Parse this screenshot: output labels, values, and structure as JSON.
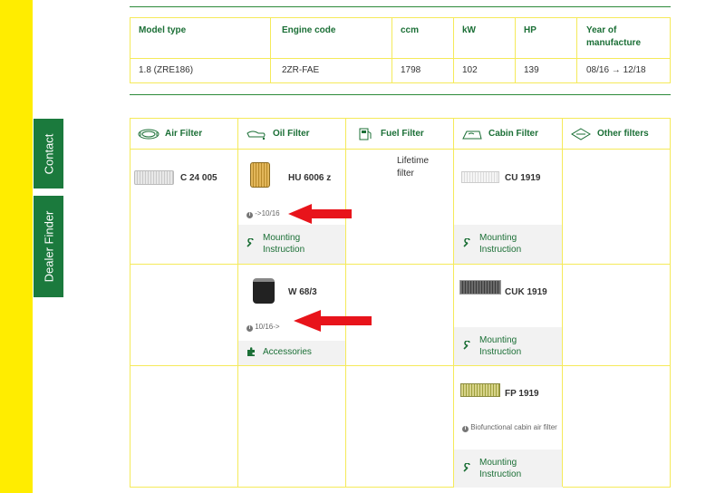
{
  "vehicle_table": {
    "headers": [
      "Model type",
      "Engine code",
      "ccm",
      "kW",
      "HP",
      "Year of\nmanufacture"
    ],
    "row": [
      "1.8 (ZRE186)",
      "2ZR-FAE",
      "1798",
      "102",
      "139",
      "08/16 → 12/18"
    ]
  },
  "filters": {
    "columns": [
      "Air Filter",
      "Oil Filter",
      "Fuel Filter",
      "Cabin Filter",
      "Other filters"
    ],
    "air": {
      "part": "C 24 005"
    },
    "oil": [
      {
        "part": "HU 6006 z",
        "note": "->10/16",
        "link": "Mounting Instruction"
      },
      {
        "part": "W 68/3",
        "note": "10/16->",
        "link": "Accessories"
      }
    ],
    "fuel": {
      "text": "Lifetime filter"
    },
    "cabin": [
      {
        "part": "CU 1919",
        "link": "Mounting Instruction"
      },
      {
        "part": "CUK 1919",
        "link": "Mounting Instruction"
      },
      {
        "part": "FP 1919",
        "note": "Biofunctional cabin air filter",
        "link": "Mounting Instruction"
      }
    ]
  },
  "side_tabs": {
    "contact": "Contact",
    "dealer_finder": "Dealer Finder"
  },
  "colors": {
    "brand_green": "#1b7a3d",
    "page_yellow": "#ffed00",
    "arrow_red": "#e8141b"
  }
}
